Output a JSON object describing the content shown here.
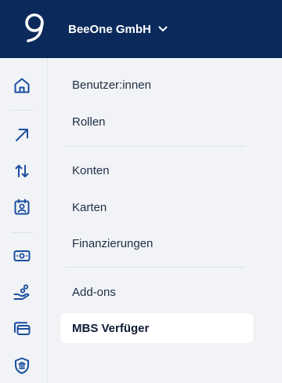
{
  "header": {
    "org_name": "BeeOne GmbH",
    "logo_icon": "beeone-logo-icon",
    "dropdown_icon": "chevron-down-icon"
  },
  "rail": {
    "items": [
      {
        "icon": "home-icon"
      },
      {
        "icon": "arrow-up-right-icon"
      },
      {
        "icon": "transfer-arrows-icon"
      },
      {
        "icon": "contact-card-icon"
      },
      {
        "icon": "banknote-icon"
      },
      {
        "icon": "hand-coins-icon"
      },
      {
        "icon": "cards-icon"
      },
      {
        "icon": "bank-shield-icon"
      }
    ]
  },
  "menu": {
    "items": [
      {
        "label": "Benutzer:innen"
      },
      {
        "label": "Rollen"
      },
      {
        "label": "Konten"
      },
      {
        "label": "Karten"
      },
      {
        "label": "Finanzierungen"
      },
      {
        "label": "Add-ons"
      },
      {
        "label": "MBS Verfüger",
        "active": true
      }
    ]
  },
  "colors": {
    "header_bg": "#0b2a5b",
    "accent": "#1a4fa0",
    "background": "#f1f3f6",
    "active_bg": "#ffffff"
  }
}
